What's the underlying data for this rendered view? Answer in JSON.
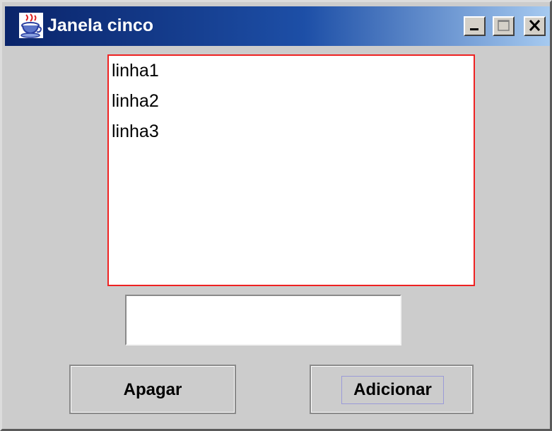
{
  "window": {
    "title": "Janela cinco"
  },
  "titlebar": {
    "icon": "java-coffee-cup-icon",
    "controls": [
      "minimize-icon",
      "maximize-icon",
      "close-icon"
    ]
  },
  "list": {
    "items": [
      "linha1",
      "linha2",
      "linha3"
    ],
    "border_color": "#ee2222"
  },
  "text_field": {
    "value": "",
    "placeholder": ""
  },
  "buttons": {
    "delete_label": "Apagar",
    "add_label": "Adicionar"
  },
  "colors": {
    "titlebar_start": "#0a246a",
    "titlebar_end": "#a6caf0",
    "window_bg": "#cccccc"
  }
}
